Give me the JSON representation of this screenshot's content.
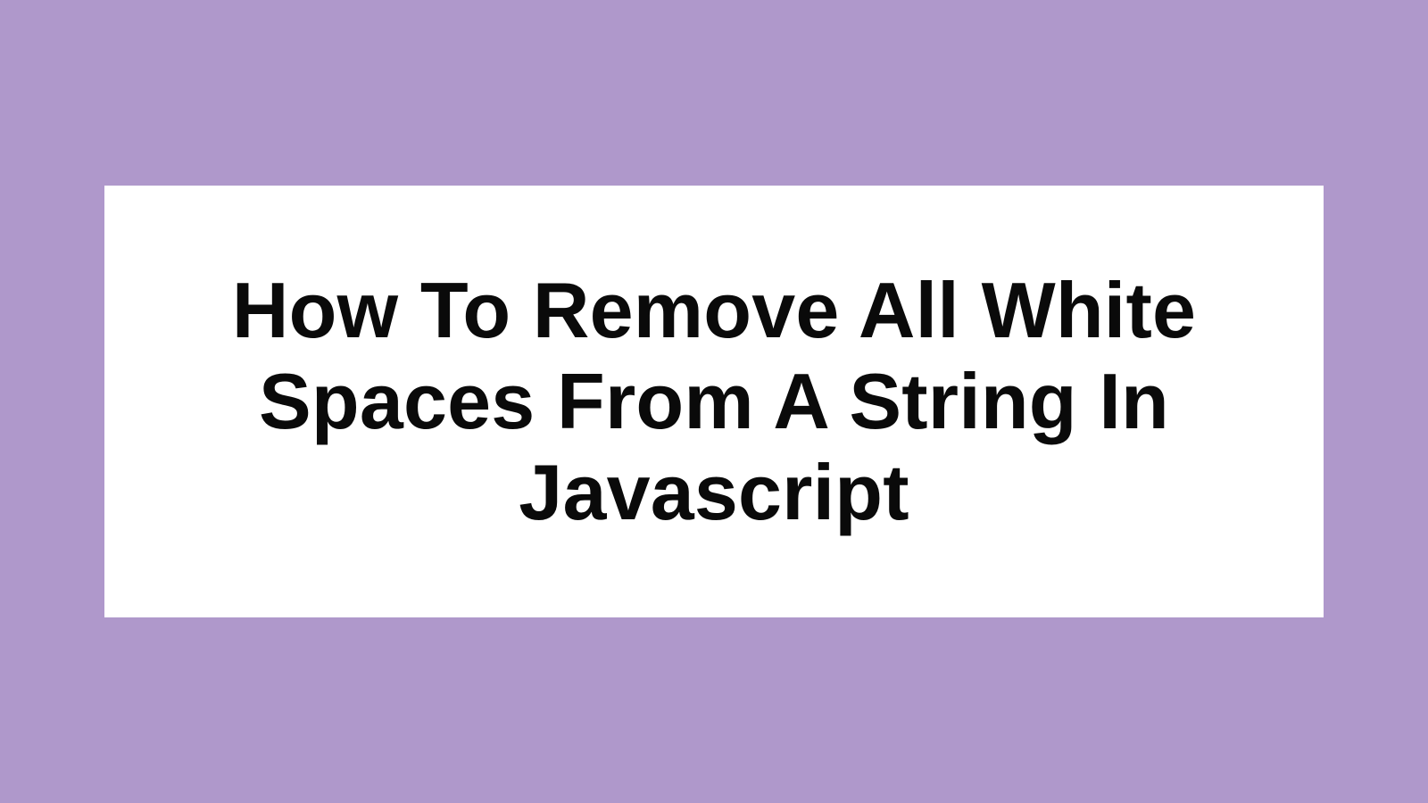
{
  "card": {
    "title": "How To Remove All White Spaces From A String In Javascript"
  },
  "colors": {
    "background": "#af98cb",
    "card": "#ffffff",
    "text": "#0a0a0a"
  }
}
